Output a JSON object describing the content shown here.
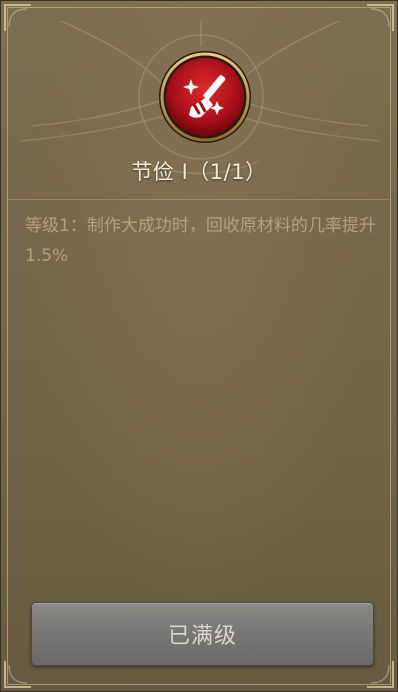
{
  "skill": {
    "icon": "broom-sparkle-icon",
    "title": "节俭 I（1/1）",
    "description": "等级1：制作大成功时，回收原材料的几率提升1.5%"
  },
  "action": {
    "max_level_label": "已满级"
  },
  "colors": {
    "panel_bg": "#766a4e",
    "icon_red": "#c0141e",
    "icon_ring": "#c9a862",
    "title_text": "#f1ead8",
    "desc_text": "#b0a27f",
    "button_bg": "#7a7876"
  }
}
